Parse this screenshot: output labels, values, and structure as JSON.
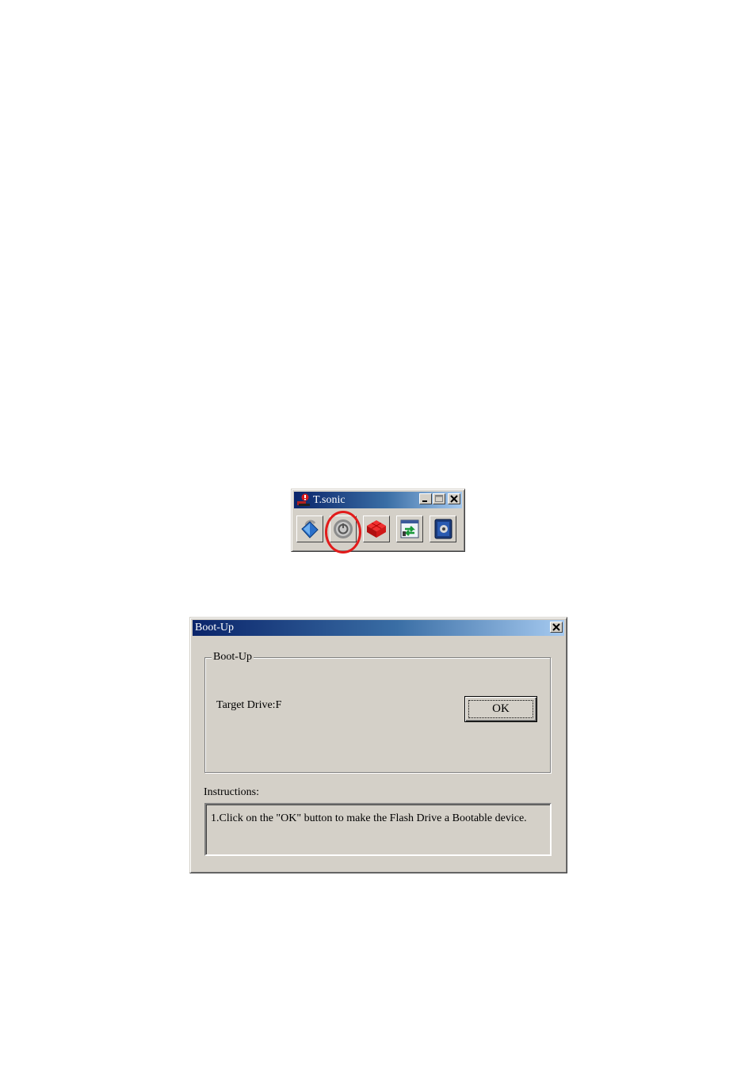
{
  "tsonic": {
    "title": "T.sonic",
    "buttons": [
      {
        "icon": "lock-icon"
      },
      {
        "icon": "power-icon"
      },
      {
        "icon": "red-blocks-icon"
      },
      {
        "icon": "sync-icon"
      },
      {
        "icon": "safe-icon"
      }
    ],
    "highlight_color": "#e21b1b"
  },
  "bootup": {
    "title": "Boot-Up",
    "group_title": "Boot-Up",
    "target_drive_label": "Target Drive:F",
    "ok_label": "OK",
    "instructions_label": "Instructions:",
    "instructions_text": "1.Click on the \"OK\" button to make the Flash Drive a Bootable device."
  },
  "colors": {
    "titlebar_start": "#0a246a",
    "titlebar_end": "#a6caf0",
    "window_face": "#d4d0c8"
  }
}
